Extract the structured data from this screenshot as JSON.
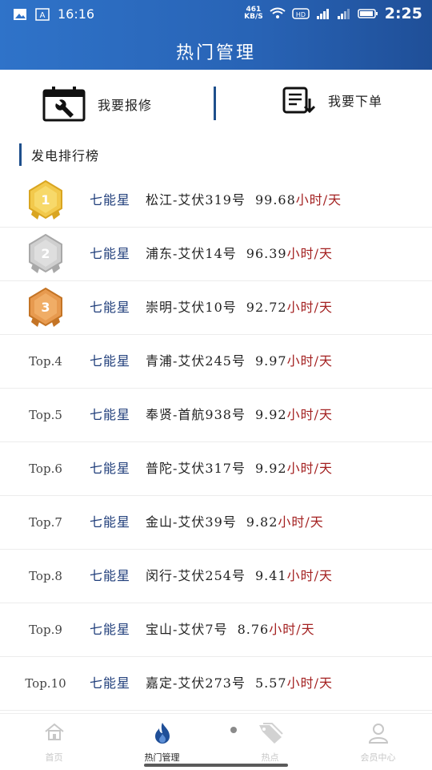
{
  "status_bar": {
    "left_time": "16:16",
    "speed_value": "461",
    "speed_unit": "KB/S",
    "clock": "2:25"
  },
  "header": {
    "title": "热门管理"
  },
  "actions": {
    "repair_label": "我要报修",
    "order_label": "我要下单"
  },
  "section": {
    "title": "发电排行榜"
  },
  "ranking": [
    {
      "rank": "1",
      "brand": "七能星",
      "station": "松江-艾伏319号",
      "value": "99.68",
      "unit": "小时/天",
      "medal": "gold"
    },
    {
      "rank": "2",
      "brand": "七能星",
      "station": "浦东-艾伏14号",
      "value": "96.39",
      "unit": "小时/天",
      "medal": "silver"
    },
    {
      "rank": "3",
      "brand": "七能星",
      "station": "崇明-艾伏10号",
      "value": "92.72",
      "unit": "小时/天",
      "medal": "bronze"
    },
    {
      "rank": "Top.4",
      "brand": "七能星",
      "station": "青浦-艾伏245号",
      "value": "9.97",
      "unit": "小时/天"
    },
    {
      "rank": "Top.5",
      "brand": "七能星",
      "station": "奉贤-首航938号",
      "value": "9.92",
      "unit": "小时/天"
    },
    {
      "rank": "Top.6",
      "brand": "七能星",
      "station": "普陀-艾伏317号",
      "value": "9.92",
      "unit": "小时/天"
    },
    {
      "rank": "Top.7",
      "brand": "七能星",
      "station": "金山-艾伏39号",
      "value": "9.82",
      "unit": "小时/天"
    },
    {
      "rank": "Top.8",
      "brand": "七能星",
      "station": "闵行-艾伏254号",
      "value": "9.41",
      "unit": "小时/天"
    },
    {
      "rank": "Top.9",
      "brand": "七能星",
      "station": "宝山-艾伏7号",
      "value": "8.76",
      "unit": "小时/天"
    },
    {
      "rank": "Top.10",
      "brand": "七能星",
      "station": "嘉定-艾伏273号",
      "value": "5.57",
      "unit": "小时/天"
    }
  ],
  "bottom_nav": {
    "home": "首页",
    "hot": "热门管理",
    "hotspot": "热点",
    "member": "会员中心"
  },
  "colors": {
    "header_blue": "#2863b5",
    "brand_navy": "#1f3d7a",
    "unit_red": "#a32020"
  }
}
